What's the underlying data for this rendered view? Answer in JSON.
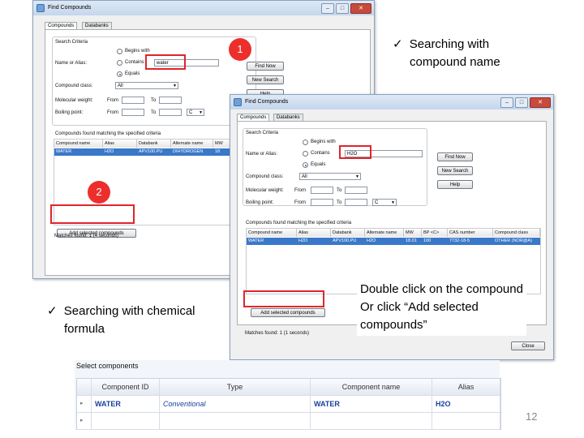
{
  "window_back": {
    "title": "Find Compounds",
    "tabs": [
      "Compounds",
      "Databanks"
    ],
    "search_criteria_label": "Search Criteria",
    "name_or_alias_label": "Name or Alias:",
    "radio_begins": "Begins with",
    "radio_contains": "Contains",
    "radio_equals": "Equals",
    "search_value": "water",
    "compound_class_label": "Compound class:",
    "compound_class_value": "All",
    "mol_weight_label": "Molecular weight:",
    "boiling_point_label": "Boiling point:",
    "from_label": "From",
    "to_label": "To",
    "unit_value": "C",
    "find_now": "Find Now",
    "new_search": "New Search",
    "help": "Help",
    "results_label": "Compounds found matching the specified criteria",
    "columns": [
      "Compound name",
      "Alias",
      "Databank",
      "Alternate name",
      "MW"
    ],
    "row": [
      "WATER",
      "H2O",
      "APV100.PU",
      "DIHYDROGEN",
      "18"
    ],
    "add_selected": "Add selected compounds",
    "matches": "Matches found: 1 (4 seconds)"
  },
  "window_front": {
    "title": "Find Compounds",
    "tabs": [
      "Compounds",
      "Databanks"
    ],
    "search_criteria_label": "Search Criteria",
    "name_or_alias_label": "Name or Alias:",
    "radio_begins": "Begins with",
    "radio_contains": "Contains",
    "radio_equals": "Equals",
    "search_value": "H2O",
    "compound_class_label": "Compound class:",
    "compound_class_value": "All",
    "mol_weight_label": "Molecular weight:",
    "boiling_point_label": "Boiling point:",
    "from_label": "From",
    "to_label": "To",
    "unit_value": "C",
    "find_now": "Find Now",
    "new_search": "New Search",
    "help": "Help",
    "results_label": "Compounds found matching the specified criteria",
    "columns": [
      "Compound name",
      "Alias",
      "Databank",
      "Alternate name",
      "MW",
      "BP <C>",
      "CAS number",
      "Compound class"
    ],
    "row": [
      "WATER",
      "H2O",
      "APV100.PU",
      "H2O",
      "18.01",
      "100",
      "7732-18-5",
      "OTHER (NOR@A)"
    ],
    "add_selected": "Add selected compounds",
    "matches": "Matches found: 1 (1 seconds)",
    "close": "Close"
  },
  "callouts": {
    "step1": "1",
    "step2": "2",
    "check": "✓",
    "note_compound_name_line1": "Searching with",
    "note_compound_name_line2": "compound name",
    "note_formula_line1": "Searching with chemical",
    "note_formula_line2": "formula",
    "note_double_click_line1": "Double click on the compound",
    "note_double_click_line2": "Or click “Add selected",
    "note_double_click_line3": "compounds”"
  },
  "select_components": {
    "title": "Select components",
    "columns": [
      "Component ID",
      "Type",
      "Component name",
      "Alias"
    ],
    "rows": [
      [
        "WATER",
        "Conventional",
        "WATER",
        "H2O"
      ],
      [
        "",
        "",
        "",
        ""
      ]
    ]
  },
  "page_number": "12",
  "colors": {
    "highlight_red": "#e0252b",
    "selected_row": "#3a78c9",
    "component_blue": "#1b3f9c"
  }
}
